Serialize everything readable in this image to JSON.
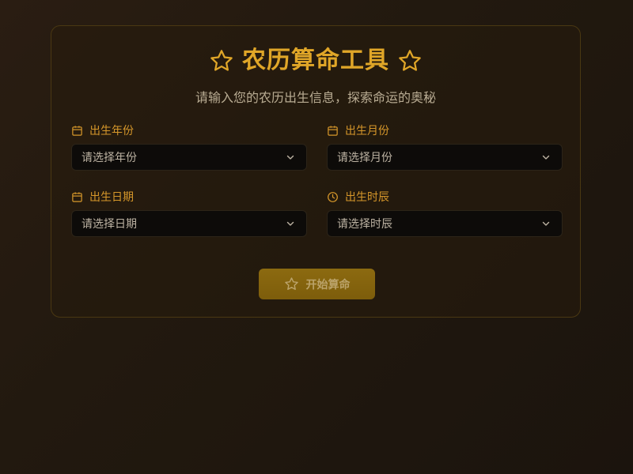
{
  "header": {
    "title": "农历算命工具",
    "subtitle": "请输入您的农历出生信息，探索命运的奥秘"
  },
  "form": {
    "fields": [
      {
        "label": "出生年份",
        "icon": "calendar-icon",
        "placeholder": "请选择年份"
      },
      {
        "label": "出生月份",
        "icon": "calendar-icon",
        "placeholder": "请选择月份"
      },
      {
        "label": "出生日期",
        "icon": "calendar-icon",
        "placeholder": "请选择日期"
      },
      {
        "label": "出生时辰",
        "icon": "clock-icon",
        "placeholder": "请选择时辰"
      }
    ],
    "submit_label": "开始算命",
    "submit_icon": "star-icon"
  },
  "colors": {
    "accent": "#e0a628",
    "label": "#d6972a",
    "button": "#8c6a10"
  }
}
